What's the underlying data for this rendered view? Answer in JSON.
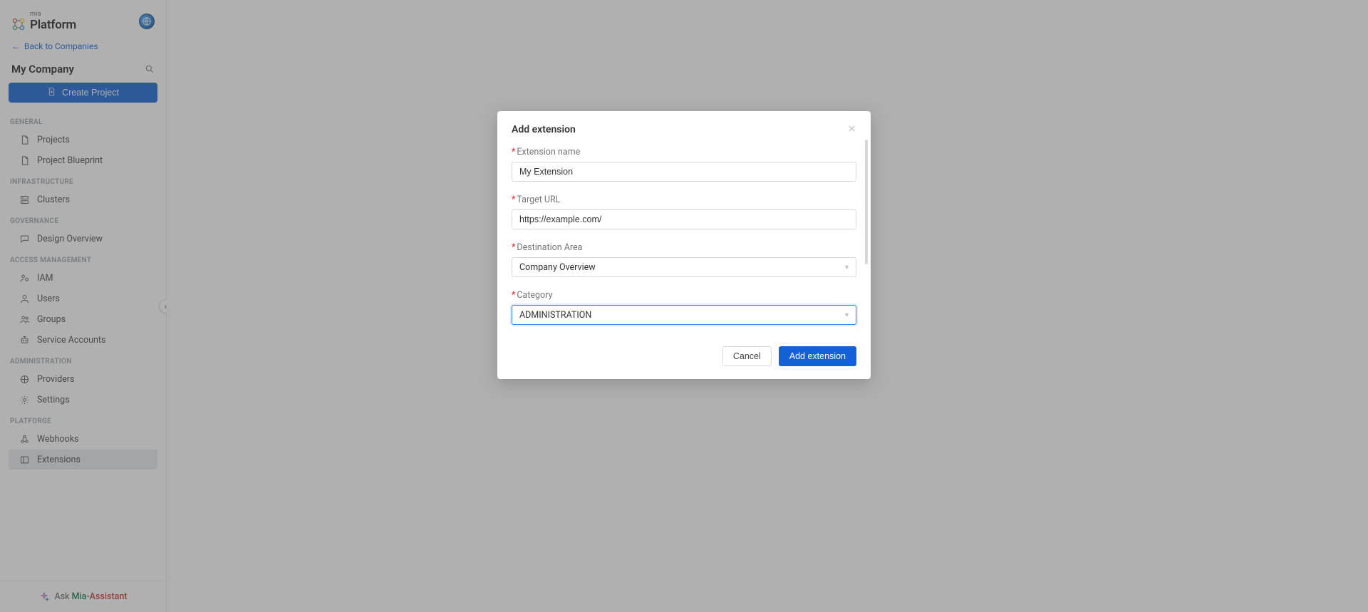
{
  "brand": {
    "mia": "mia",
    "platform": "Platform"
  },
  "backLink": "Back to Companies",
  "companyName": "My Company",
  "createProject": "Create Project",
  "navSections": [
    {
      "title": "GENERAL",
      "items": [
        {
          "id": "projects",
          "label": "Projects",
          "icon": "file"
        },
        {
          "id": "blueprint",
          "label": "Project Blueprint",
          "icon": "file"
        }
      ]
    },
    {
      "title": "INFRASTRUCTURE",
      "items": [
        {
          "id": "clusters",
          "label": "Clusters",
          "icon": "server"
        }
      ]
    },
    {
      "title": "GOVERNANCE",
      "items": [
        {
          "id": "design",
          "label": "Design Overview",
          "icon": "chat"
        }
      ]
    },
    {
      "title": "ACCESS MANAGEMENT",
      "items": [
        {
          "id": "iam",
          "label": "IAM",
          "icon": "users-cog"
        },
        {
          "id": "users",
          "label": "Users",
          "icon": "user"
        },
        {
          "id": "groups",
          "label": "Groups",
          "icon": "users"
        },
        {
          "id": "sa",
          "label": "Service Accounts",
          "icon": "robot"
        }
      ]
    },
    {
      "title": "ADMINISTRATION",
      "items": [
        {
          "id": "providers",
          "label": "Providers",
          "icon": "provider"
        },
        {
          "id": "settings",
          "label": "Settings",
          "icon": "gear"
        }
      ]
    },
    {
      "title": "PLATFORGE",
      "items": [
        {
          "id": "webhooks",
          "label": "Webhooks",
          "icon": "webhook"
        },
        {
          "id": "extensions",
          "label": "Extensions",
          "icon": "panel",
          "active": true
        }
      ]
    }
  ],
  "assistant": {
    "prefix": "Ask ",
    "brand1": "Mia-",
    "brand2": "Assistant"
  },
  "modal": {
    "title": "Add extension",
    "fields": {
      "name": {
        "label": "Extension name",
        "value": "My Extension"
      },
      "url": {
        "label": "Target URL",
        "value": "https://example.com/"
      },
      "area": {
        "label": "Destination Area",
        "value": "Company Overview"
      },
      "category": {
        "label": "Category",
        "value": "ADMINISTRATION"
      }
    },
    "buttons": {
      "cancel": "Cancel",
      "submit": "Add extension"
    }
  }
}
